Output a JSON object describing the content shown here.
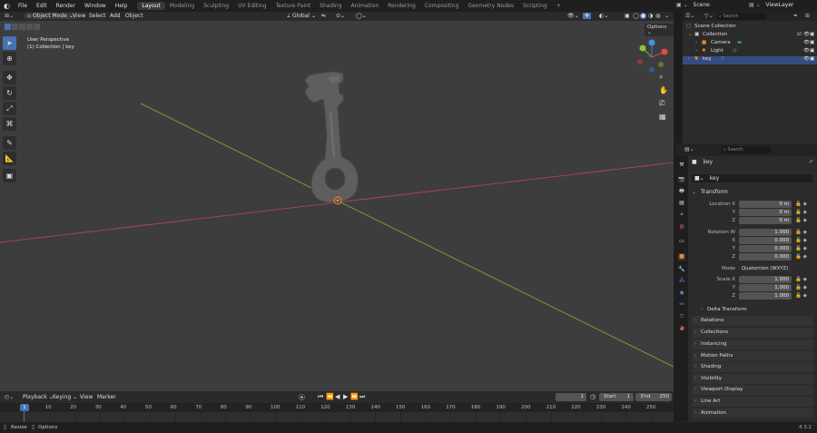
{
  "topbar": {
    "menus": [
      "File",
      "Edit",
      "Render",
      "Window",
      "Help"
    ],
    "workspaces": [
      "Layout",
      "Modeling",
      "Sculpting",
      "UV Editing",
      "Texture Paint",
      "Shading",
      "Animation",
      "Rendering",
      "Compositing",
      "Geometry Nodes",
      "Scripting"
    ],
    "active_workspace": "Layout",
    "add_tab": "+",
    "scene": "Scene",
    "view_layer": "ViewLayer"
  },
  "viewport_header": {
    "mode": "Object Mode",
    "menus": [
      "View",
      "Select",
      "Add",
      "Object"
    ],
    "transform_orientation": "Global",
    "options": "Options"
  },
  "viewport": {
    "perspective_label": "User Perspective",
    "collection_label": "(1) Collection | key"
  },
  "outliner": {
    "search_placeholder": "Search",
    "items": [
      {
        "label": "Scene Collection"
      },
      {
        "label": "Collection"
      },
      {
        "label": "Camera"
      },
      {
        "label": "Light"
      },
      {
        "label": "key"
      }
    ]
  },
  "properties": {
    "search_placeholder": "Search",
    "object_name": "key",
    "data_name": "key",
    "transform_title": "Transform",
    "location_label": "Location X",
    "location": [
      "0 m",
      "0 m",
      "0 m"
    ],
    "rotation_label": "Rotation W",
    "rotation": [
      "1.000",
      "0.000",
      "0.000",
      "0.000"
    ],
    "axis_labels": [
      "Y",
      "Z",
      "X",
      "Y",
      "Z",
      "Y",
      "Z"
    ],
    "mode_label": "Mode",
    "mode_value": "Quaternion (WXYZ)",
    "scale_label": "Scale X",
    "scale": [
      "1.000",
      "1.000",
      "1.000"
    ],
    "delta_transform": "Delta Transform",
    "panels": [
      "Relations",
      "Collections",
      "Instancing",
      "Motion Paths",
      "Shading",
      "Visibility",
      "Viewport Display",
      "Line Art",
      "Animation"
    ]
  },
  "timeline": {
    "menus": [
      "Playback",
      "Keying",
      "View",
      "Marker"
    ],
    "current_frame": "1",
    "start_label": "Start",
    "start": "1",
    "end_label": "End",
    "end": "250",
    "ticks": [
      "10",
      "20",
      "30",
      "40",
      "50",
      "60",
      "70",
      "80",
      "90",
      "100",
      "110",
      "120",
      "130",
      "140",
      "150",
      "160",
      "170",
      "180",
      "190",
      "200",
      "210",
      "220",
      "230",
      "240",
      "250"
    ],
    "playhead": "1"
  },
  "statusbar": {
    "left": "Resize",
    "middle": "Options",
    "version": "4.3.2"
  },
  "colors": {
    "accent": "#4772b3",
    "x_axis": "#b8424a",
    "y_axis": "#7da82a",
    "origin": "#f08a24"
  }
}
